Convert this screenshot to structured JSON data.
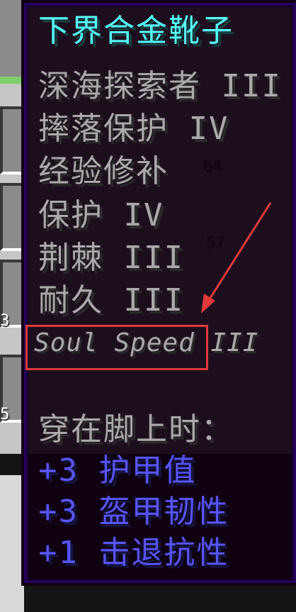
{
  "background": {
    "slot_numbers": [
      "64",
      "57",
      "3",
      "5"
    ]
  },
  "tooltip": {
    "title": "下界合金靴子",
    "enchantments": [
      "深海探索者 III",
      "摔落保护 IV",
      "经验修补",
      "保护 IV",
      "荆棘 III",
      "耐久 III"
    ],
    "soul_speed": "Soul Speed",
    "soul_speed_level": "III",
    "attributes_header": "穿在脚上时：",
    "attributes": [
      "+3 护甲值",
      "+3 盔甲韧性",
      "+1 击退抗性"
    ]
  },
  "colors": {
    "title": "#55ffff",
    "enchantment": "#aaaaaa",
    "attribute": "#5555ff",
    "annotation": "#e23a3a",
    "tooltip_border": "#25015b"
  },
  "annotation": {
    "target": "Soul Speed III",
    "icon": "red-arrow-icon"
  }
}
